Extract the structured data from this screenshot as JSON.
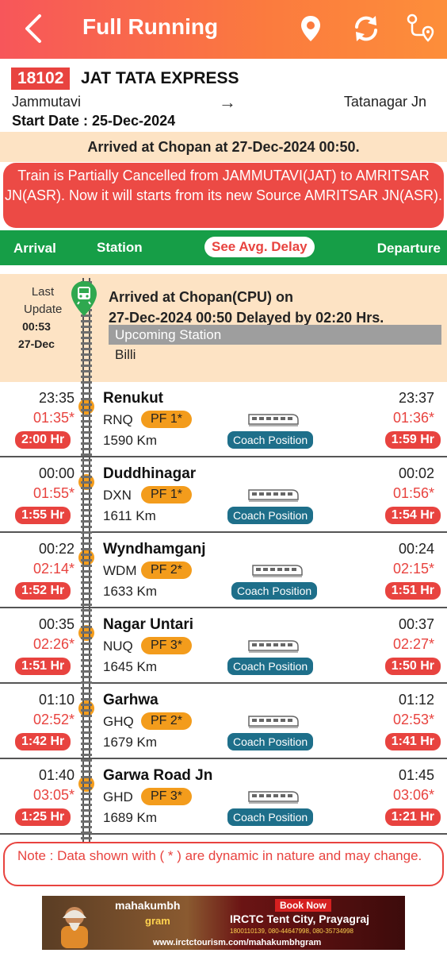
{
  "header": {
    "title": "Full Running",
    "icons": [
      "back-arrow-icon",
      "location-pin-icon",
      "refresh-icon",
      "route-icon"
    ]
  },
  "train": {
    "number": "18102",
    "name": "JAT TATA EXPRESS",
    "source": "Jammutavi",
    "arrow": "→",
    "destination": "Tatanagar Jn",
    "start_date": "Start Date : 25-Dec-2024"
  },
  "status": {
    "arrived": "Arrived at Chopan at 27-Dec-2024 00:50.",
    "cancel_notice": "Train is Partially Cancelled from JAMMUTAVI(JAT) to AMRITSAR JN(ASR). Now it will starts from its new Source AMRITSAR JN(ASR)."
  },
  "columns": {
    "arrival": "Arrival",
    "station": "Station",
    "avg_delay": "See Avg. Delay",
    "departure": "Departure"
  },
  "live": {
    "last_label_1": "Last",
    "last_label_2": "Update",
    "last_time": "00:53",
    "last_date": "27-Dec",
    "message_1": "Arrived at Chopan(CPU) on",
    "message_2": "27-Dec-2024 00:50 Delayed by 02:20 Hrs.",
    "upcoming_label": "Upcoming Station",
    "upcoming_station": "Billi"
  },
  "coach_label": "Coach Position",
  "stations": [
    {
      "name": "Renukut",
      "code": "RNQ",
      "pf": "PF 1*",
      "km": "1590 Km",
      "sch_arr": "23:35",
      "act_arr": "01:35*",
      "delay_arr": "2:00 Hr",
      "sch_dep": "23:37",
      "act_dep": "01:36*",
      "delay_dep": "1:59 Hr"
    },
    {
      "name": "Duddhinagar",
      "code": "DXN",
      "pf": "PF 1*",
      "km": "1611 Km",
      "sch_arr": "00:00",
      "act_arr": "01:55*",
      "delay_arr": "1:55 Hr",
      "sch_dep": "00:02",
      "act_dep": "01:56*",
      "delay_dep": "1:54 Hr"
    },
    {
      "name": "Wyndhamganj",
      "code": "WDM",
      "pf": "PF 2*",
      "km": "1633 Km",
      "sch_arr": "00:22",
      "act_arr": "02:14*",
      "delay_arr": "1:52 Hr",
      "sch_dep": "00:24",
      "act_dep": "02:15*",
      "delay_dep": "1:51 Hr"
    },
    {
      "name": "Nagar Untari",
      "code": "NUQ",
      "pf": "PF 3*",
      "km": "1645 Km",
      "sch_arr": "00:35",
      "act_arr": "02:26*",
      "delay_arr": "1:51 Hr",
      "sch_dep": "00:37",
      "act_dep": "02:27*",
      "delay_dep": "1:50 Hr"
    },
    {
      "name": "Garhwa",
      "code": "GHQ",
      "pf": "PF 2*",
      "km": "1679 Km",
      "sch_arr": "01:10",
      "act_arr": "02:52*",
      "delay_arr": "1:42 Hr",
      "sch_dep": "01:12",
      "act_dep": "02:53*",
      "delay_dep": "1:41 Hr"
    },
    {
      "name": "Garwa Road Jn",
      "code": "GHD",
      "pf": "PF 3*",
      "km": "1689 Km",
      "sch_arr": "01:40",
      "act_arr": "03:05*",
      "delay_arr": "1:25 Hr",
      "sch_dep": "01:45",
      "act_dep": "03:06*",
      "delay_dep": "1:21 Hr"
    }
  ],
  "note": "Note : Data shown with ( * ) are dynamic in nature and may change.",
  "ad": {
    "brand": "mahakumbh",
    "brand_sub": "gram",
    "book_now": "Book Now",
    "title": "IRCTC Tent City, Prayagraj",
    "phone": "1800110139, 080-44647998, 080-35734998",
    "url": "www.irctctourism.com/mahakumbhgram"
  }
}
